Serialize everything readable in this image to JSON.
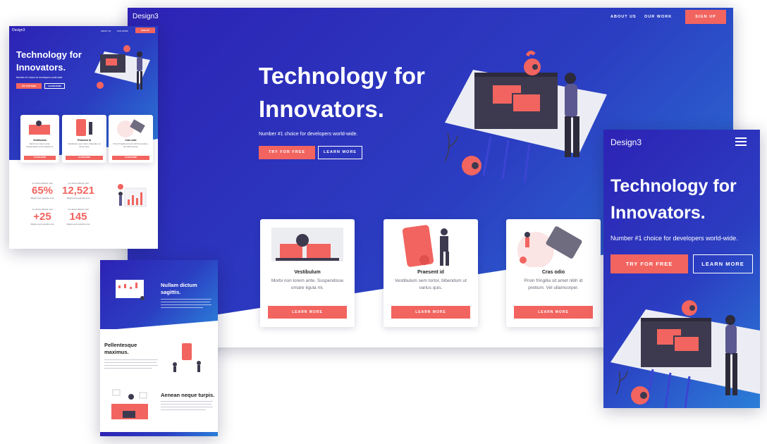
{
  "brand": "Design3",
  "nav": {
    "about": "ABOUT US",
    "work": "OUR WORK",
    "signup": "SIGN UP"
  },
  "hero": {
    "title_line1": "Technology for",
    "title_line2": "Innovators.",
    "subtitle": "Number #1 choice for developers world-wide.",
    "cta_primary": "TRY FOR FREE",
    "cta_secondary": "LEARN MORE"
  },
  "cards": [
    {
      "title": "Vestibulum",
      "text": "Morbi non lorem ante. Suspendisse ornare ligula mi.",
      "button": "LEARN MORE"
    },
    {
      "title": "Praesent id",
      "text": "Vestibulum sem tortor, bibendum ut varius quis.",
      "button": "LEARN MORE"
    },
    {
      "title": "Cras odio",
      "text": "Proin fringilla sit amet nibh id pretium. Vel ullamcorper.",
      "button": "LEARN MORE"
    }
  ],
  "stats": [
    {
      "value": "65%",
      "label": "Cu dictus efficitur velit",
      "sub": "Magna quis gravida uma"
    },
    {
      "value": "12,521",
      "label": "Cu dictus efficitur velit",
      "sub": "Magna quis gravida uma"
    },
    {
      "value": "+25",
      "label": "Cu dictus efficitur velit",
      "sub": "Magna quis gravida uma"
    },
    {
      "value": "145",
      "label": "Cu dictus efficitur velit",
      "sub": "Magna quis gravida uma"
    }
  ],
  "features": [
    {
      "title_line1": "Nullam dictum",
      "title_line2": "sagittis."
    },
    {
      "title_line1": "Pellentesque",
      "title_line2": "maximus."
    },
    {
      "title_line1": "Aenean neque turpis.",
      "title_line2": ""
    }
  ],
  "colors": {
    "accent": "#f2645f",
    "gradient_start": "#2d22b4",
    "gradient_end": "#2b7fd8",
    "dark": "#3d3a4f"
  }
}
